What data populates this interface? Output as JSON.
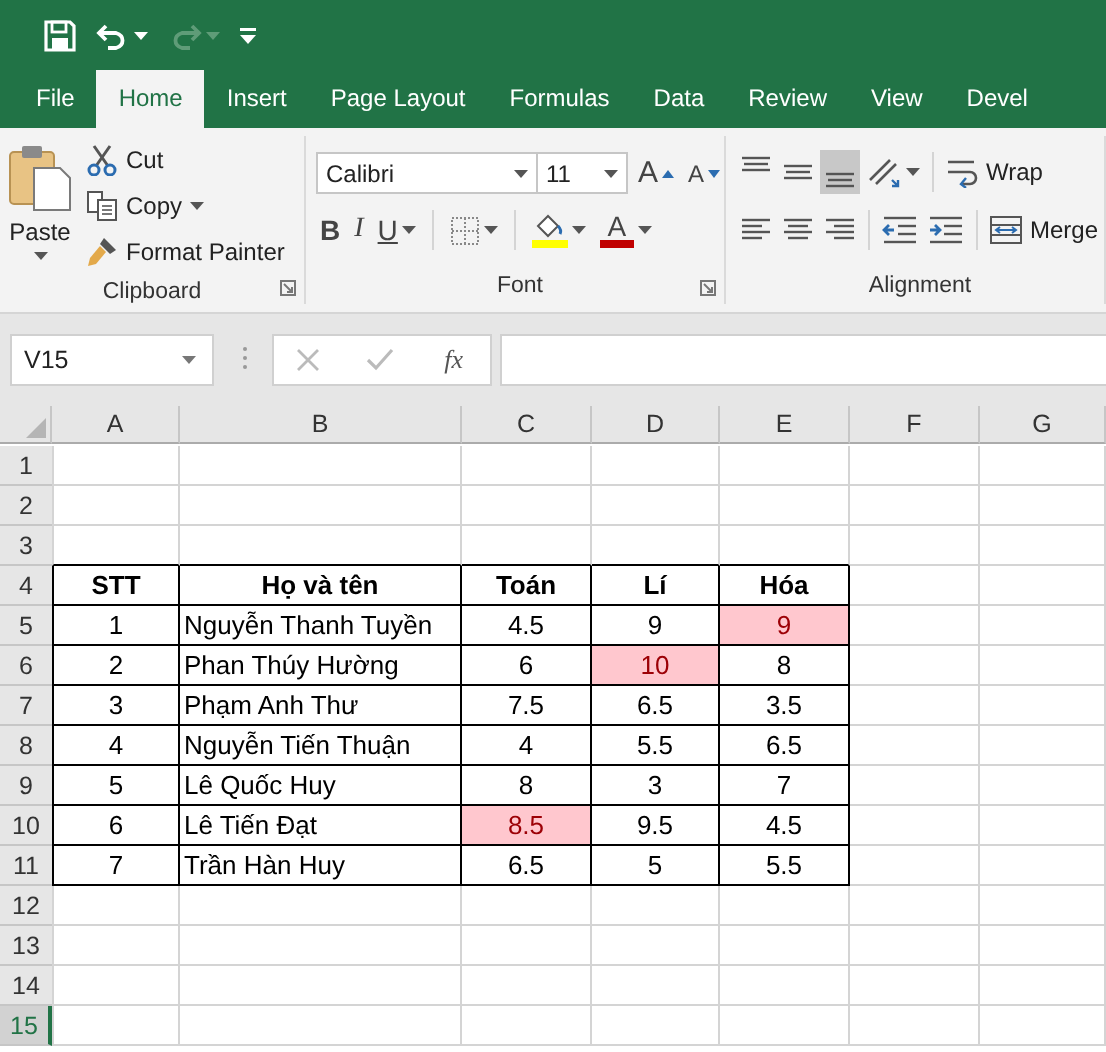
{
  "quick_access": {
    "redo": {
      "disabled": true
    }
  },
  "tabs": [
    {
      "label": "File",
      "selected": false
    },
    {
      "label": "Home",
      "selected": true
    },
    {
      "label": "Insert",
      "selected": false
    },
    {
      "label": "Page Layout",
      "selected": false
    },
    {
      "label": "Formulas",
      "selected": false
    },
    {
      "label": "Data",
      "selected": false
    },
    {
      "label": "Review",
      "selected": false
    },
    {
      "label": "View",
      "selected": false
    },
    {
      "label": "Devel",
      "selected": false
    }
  ],
  "ribbon": {
    "clipboard": {
      "paste": "Paste",
      "cut": "Cut",
      "copy": "Copy",
      "format_painter": "Format Painter",
      "label": "Clipboard"
    },
    "font": {
      "name": "Calibri",
      "size": "11",
      "grow": "A",
      "shrink": "A",
      "bold": "B",
      "italic": "I",
      "underline": "U",
      "font_color": "A",
      "label": "Font"
    },
    "alignment": {
      "vertical": [
        {
          "kind": "top",
          "selected": false
        },
        {
          "kind": "middle",
          "selected": false
        },
        {
          "kind": "bottom",
          "selected": true
        }
      ],
      "wrap": "Wrap",
      "merge": "Merge",
      "label": "Alignment"
    }
  },
  "formula_bar": {
    "name_box": "V15",
    "fx": "fx"
  },
  "sheet": {
    "columns": [
      "A",
      "B",
      "C",
      "D",
      "E",
      "F",
      "G"
    ],
    "rows": [
      {
        "label": "1",
        "selected": false
      },
      {
        "label": "2",
        "selected": false
      },
      {
        "label": "3",
        "selected": false
      },
      {
        "label": "4",
        "selected": false,
        "kind": "header",
        "cells": [
          {
            "text": "STT",
            "highlighted": false
          },
          {
            "text": "Họ và tên",
            "highlighted": false
          },
          {
            "text": "Toán",
            "highlighted": false
          },
          {
            "text": "Lí",
            "highlighted": false
          },
          {
            "text": "Hóa",
            "highlighted": false
          }
        ]
      },
      {
        "label": "5",
        "selected": false,
        "kind": "data",
        "cells": [
          {
            "text": "1",
            "highlighted": false
          },
          {
            "text": "Nguyễn Thanh Tuyền",
            "highlighted": false
          },
          {
            "text": "4.5",
            "highlighted": false
          },
          {
            "text": "9",
            "highlighted": false
          },
          {
            "text": "9",
            "highlighted": true
          }
        ]
      },
      {
        "label": "6",
        "selected": false,
        "kind": "data",
        "cells": [
          {
            "text": "2",
            "highlighted": false
          },
          {
            "text": "Phan Thúy Hường",
            "highlighted": false
          },
          {
            "text": "6",
            "highlighted": false
          },
          {
            "text": "10",
            "highlighted": true
          },
          {
            "text": "8",
            "highlighted": false
          }
        ]
      },
      {
        "label": "7",
        "selected": false,
        "kind": "data",
        "cells": [
          {
            "text": "3",
            "highlighted": false
          },
          {
            "text": "Phạm Anh Thư",
            "highlighted": false
          },
          {
            "text": "7.5",
            "highlighted": false
          },
          {
            "text": "6.5",
            "highlighted": false
          },
          {
            "text": "3.5",
            "highlighted": false
          }
        ]
      },
      {
        "label": "8",
        "selected": false,
        "kind": "data",
        "cells": [
          {
            "text": "4",
            "highlighted": false
          },
          {
            "text": "Nguyễn Tiến Thuận",
            "highlighted": false
          },
          {
            "text": "4",
            "highlighted": false
          },
          {
            "text": "5.5",
            "highlighted": false
          },
          {
            "text": "6.5",
            "highlighted": false
          }
        ]
      },
      {
        "label": "9",
        "selected": false,
        "kind": "data",
        "cells": [
          {
            "text": "5",
            "highlighted": false
          },
          {
            "text": "Lê Quốc Huy",
            "highlighted": false
          },
          {
            "text": "8",
            "highlighted": false
          },
          {
            "text": "3",
            "highlighted": false
          },
          {
            "text": "7",
            "highlighted": false
          }
        ]
      },
      {
        "label": "10",
        "selected": false,
        "kind": "data",
        "cells": [
          {
            "text": "6",
            "highlighted": false
          },
          {
            "text": "Lê Tiến Đạt",
            "highlighted": false
          },
          {
            "text": "8.5",
            "highlighted": true
          },
          {
            "text": "9.5",
            "highlighted": false
          },
          {
            "text": "4.5",
            "highlighted": false
          }
        ]
      },
      {
        "label": "11",
        "selected": false,
        "kind": "data",
        "cells": [
          {
            "text": "7",
            "highlighted": false
          },
          {
            "text": "Trần Hàn Huy",
            "highlighted": false
          },
          {
            "text": "6.5",
            "highlighted": false
          },
          {
            "text": "5",
            "highlighted": false
          },
          {
            "text": "5.5",
            "highlighted": false
          }
        ]
      },
      {
        "label": "12",
        "selected": false
      },
      {
        "label": "13",
        "selected": false
      },
      {
        "label": "14",
        "selected": false
      },
      {
        "label": "15",
        "selected": true
      }
    ]
  }
}
